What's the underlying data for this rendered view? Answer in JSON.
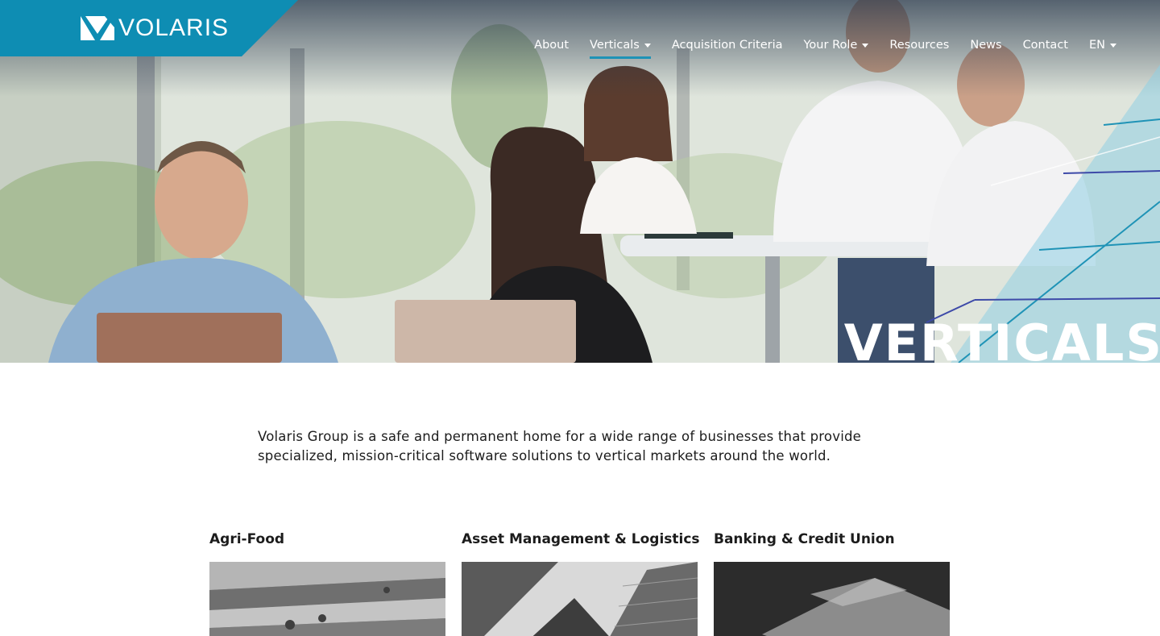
{
  "brand": {
    "name": "VOLARIS",
    "primary_color": "#0e8db3",
    "accent_color": "#1f93b6"
  },
  "nav": {
    "items": [
      {
        "label": "About",
        "has_dropdown": false,
        "active": false
      },
      {
        "label": "Verticals",
        "has_dropdown": true,
        "active": true
      },
      {
        "label": "Acquisition Criteria",
        "has_dropdown": false,
        "active": false
      },
      {
        "label": "Your Role",
        "has_dropdown": true,
        "active": false
      },
      {
        "label": "Resources",
        "has_dropdown": false,
        "active": false
      },
      {
        "label": "News",
        "has_dropdown": false,
        "active": false
      },
      {
        "label": "Contact",
        "has_dropdown": false,
        "active": false
      },
      {
        "label": "EN",
        "has_dropdown": true,
        "active": false
      }
    ]
  },
  "hero": {
    "title": "VERTICALS"
  },
  "intro": {
    "text": "Volaris Group is a safe and permanent home for a wide range of businesses that provide specialized, mission-critical software solutions to vertical markets around the world."
  },
  "verticals": [
    {
      "title": "Agri-Food",
      "image": "farm-fields-photo"
    },
    {
      "title": "Asset Management & Logistics",
      "image": "skyscrapers-photo"
    },
    {
      "title": "Banking & Credit Union",
      "image": "credit-card-photo"
    }
  ]
}
